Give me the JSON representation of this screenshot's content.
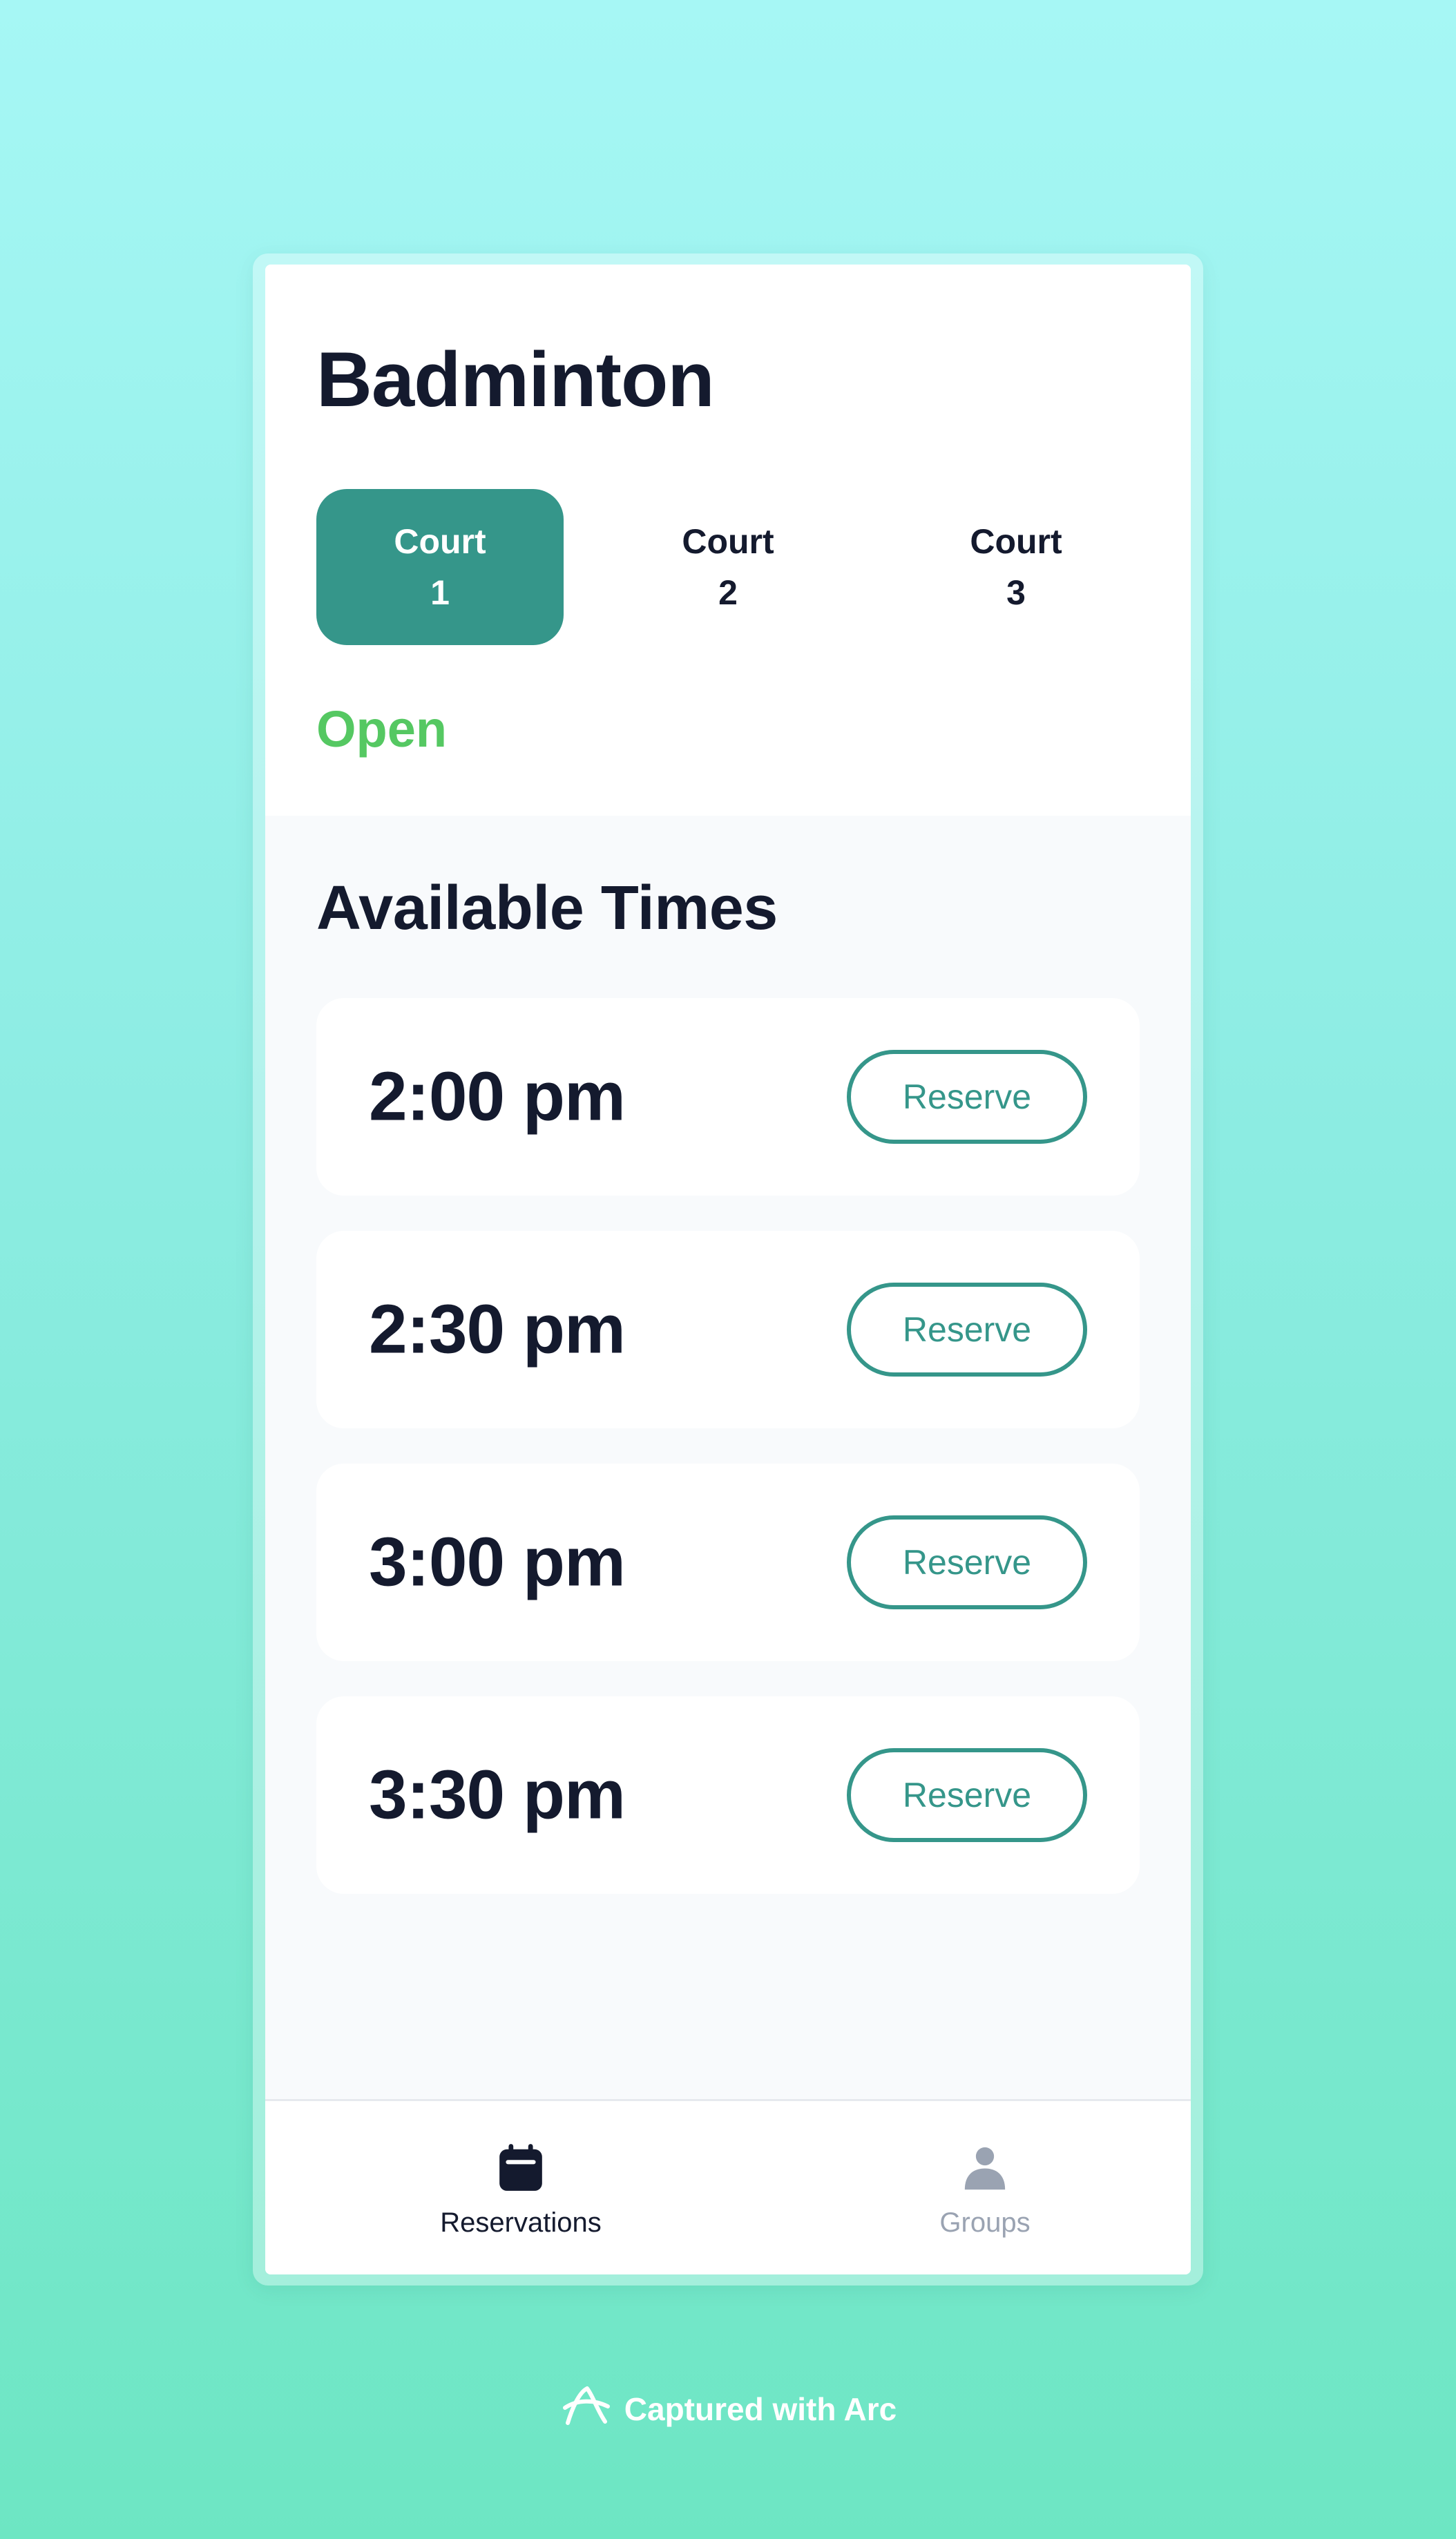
{
  "colors": {
    "accent": "#35968a",
    "status_open": "#55c862",
    "text_dark": "#141a2e",
    "nav_inactive": "#9aa3b2"
  },
  "header": {
    "title": "Badminton"
  },
  "courts": [
    {
      "line1": "Court",
      "line2": "1",
      "selected": true
    },
    {
      "line1": "Court",
      "line2": "2",
      "selected": false
    },
    {
      "line1": "Court",
      "line2": "3",
      "selected": false
    }
  ],
  "status": {
    "label": "Open"
  },
  "available": {
    "title": "Available Times",
    "slots": [
      {
        "time": "2:00 pm",
        "action": "Reserve"
      },
      {
        "time": "2:30 pm",
        "action": "Reserve"
      },
      {
        "time": "3:00 pm",
        "action": "Reserve"
      },
      {
        "time": "3:30 pm",
        "action": "Reserve"
      }
    ]
  },
  "nav": {
    "items": [
      {
        "label": "Reservations",
        "icon": "calendar-icon",
        "active": true
      },
      {
        "label": "Groups",
        "icon": "user-icon",
        "active": false
      }
    ]
  },
  "watermark": {
    "text": "Captured with Arc",
    "icon": "arc-logo-icon"
  }
}
